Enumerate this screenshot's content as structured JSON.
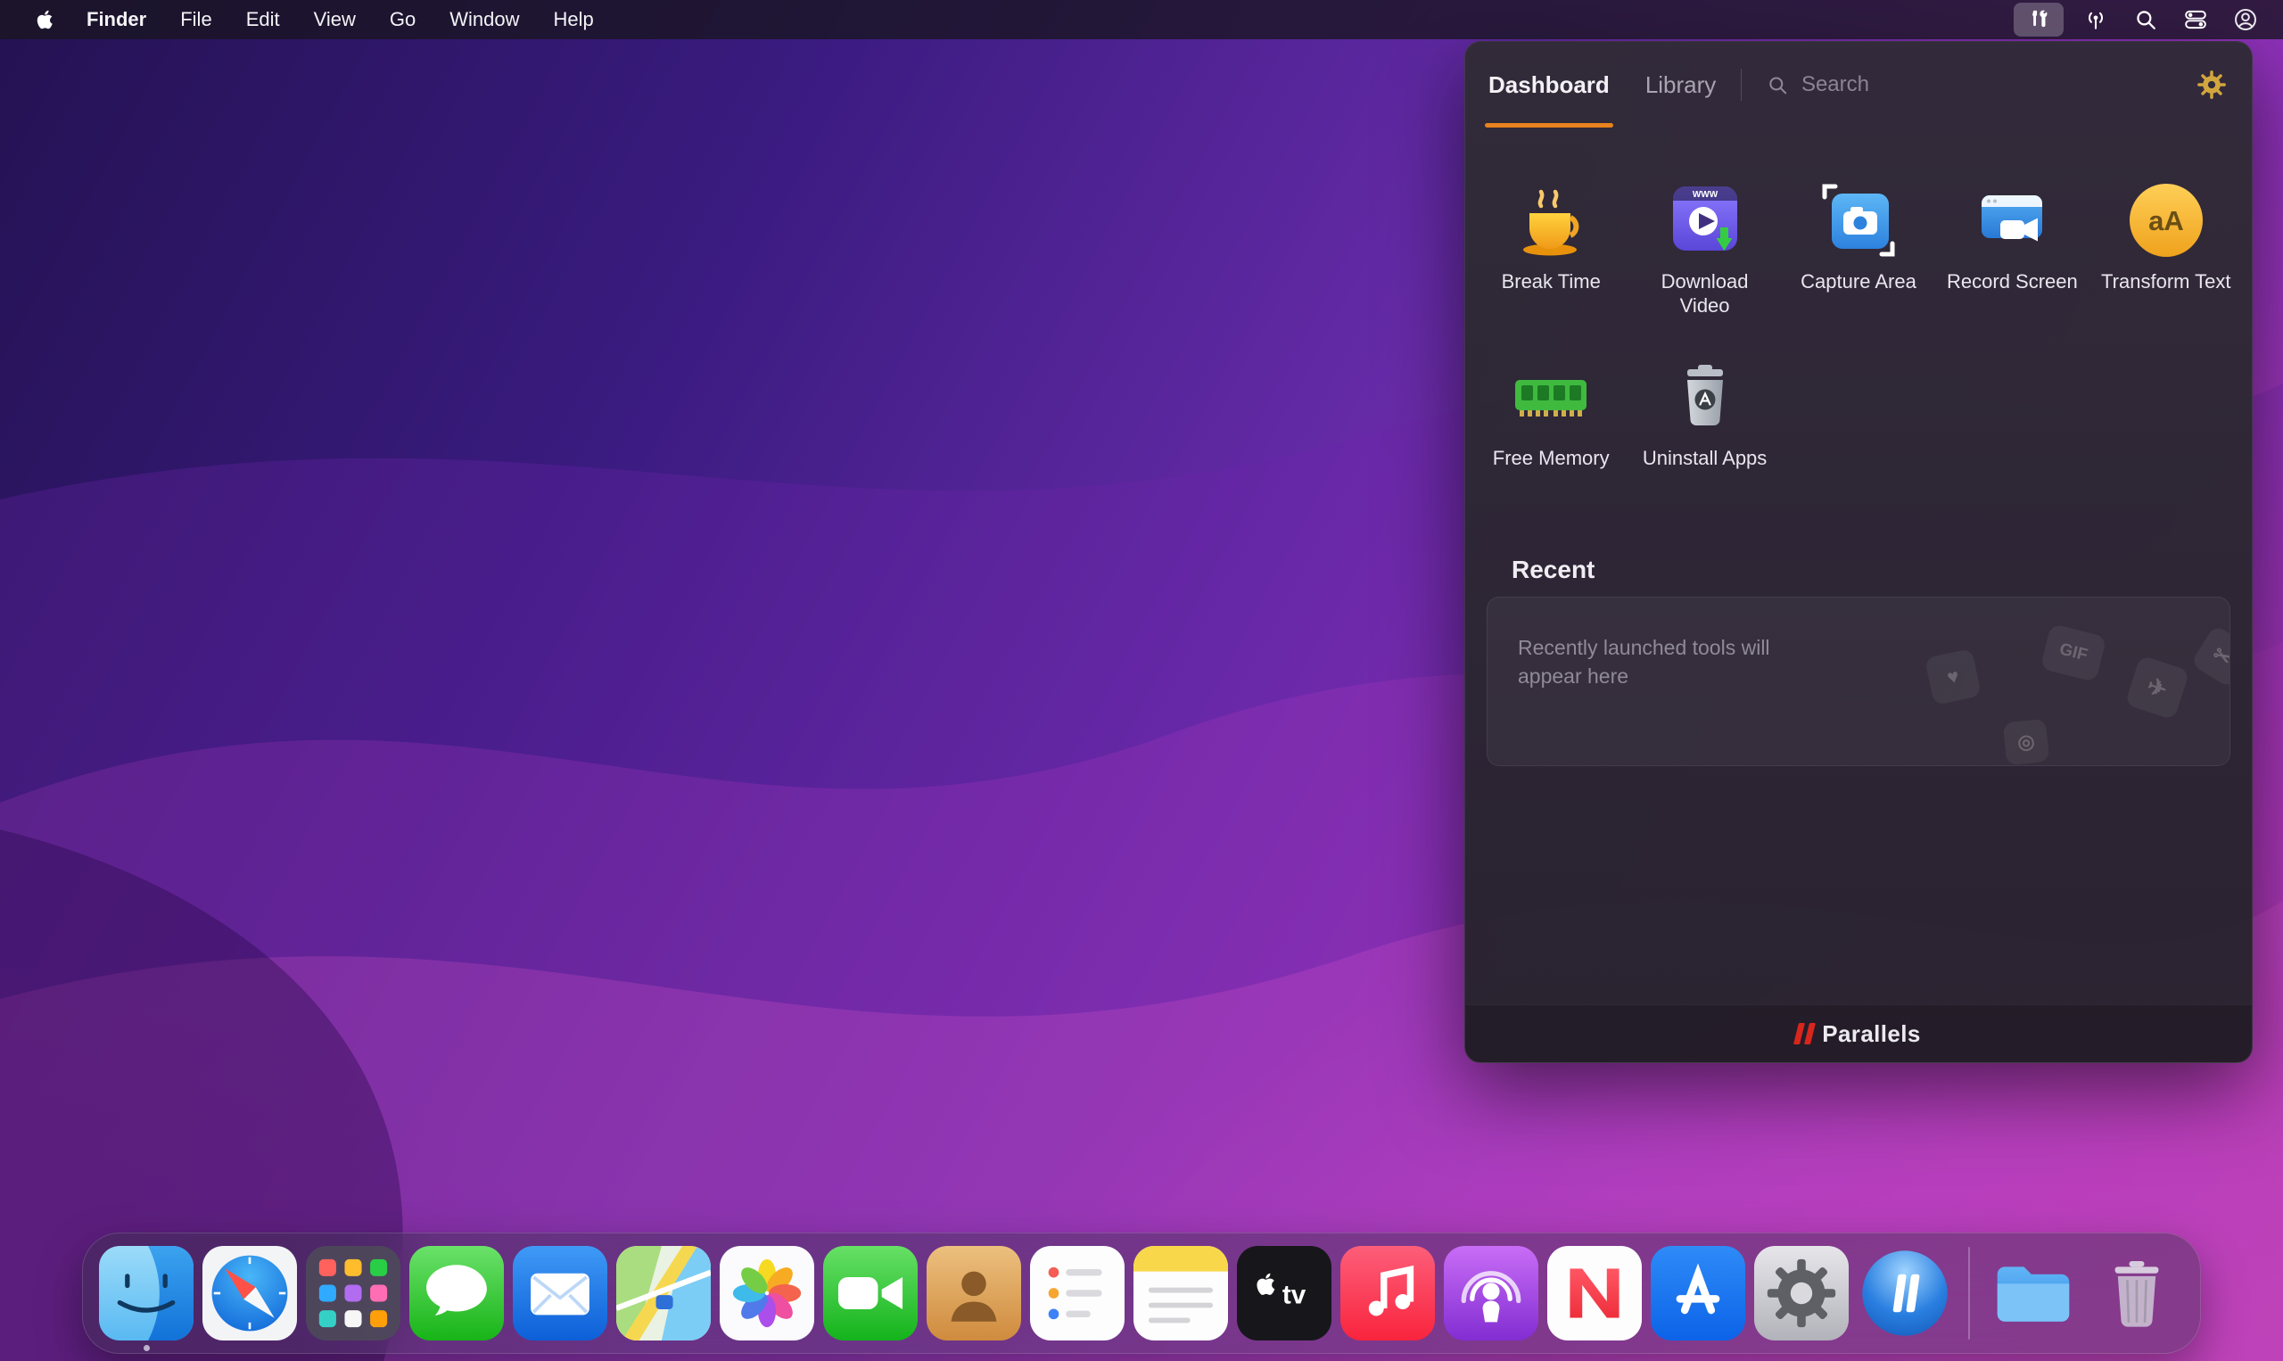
{
  "menu_bar": {
    "app_name": "Finder",
    "items": [
      "File",
      "Edit",
      "View",
      "Go",
      "Window",
      "Help"
    ],
    "status_icons": [
      "parallels-toolbox",
      "wireless-antenna",
      "spotlight-search",
      "control-center",
      "account"
    ]
  },
  "panel": {
    "tabs": [
      {
        "label": "Dashboard",
        "active": true
      },
      {
        "label": "Library",
        "active": false
      }
    ],
    "search": {
      "placeholder": "Search"
    },
    "tools": [
      {
        "label": "Break Time",
        "icon": "coffee-cup-icon"
      },
      {
        "label": "Download Video",
        "icon": "download-video-icon",
        "badge": "WWW"
      },
      {
        "label": "Capture Area",
        "icon": "capture-area-icon"
      },
      {
        "label": "Record Screen",
        "icon": "record-screen-icon"
      },
      {
        "label": "Transform Text",
        "icon": "transform-text-icon",
        "icon_text": "aA"
      },
      {
        "label": "Free Memory",
        "icon": "ram-icon"
      },
      {
        "label": "Uninstall Apps",
        "icon": "uninstall-apps-icon"
      }
    ],
    "recent": {
      "heading": "Recent",
      "empty_text": "Recently launched tools will appear here",
      "ghost_icons": [
        {
          "name": "heart",
          "glyph": "♥"
        },
        {
          "name": "gif",
          "glyph": "GIF"
        },
        {
          "name": "camera",
          "glyph": "◎"
        },
        {
          "name": "airplane",
          "glyph": "✈"
        },
        {
          "name": "sticker",
          "glyph": "✂"
        }
      ]
    },
    "brand": "Parallels"
  },
  "dock": {
    "tv_label": "tv",
    "apps": [
      "Finder",
      "Safari",
      "Launchpad",
      "Messages",
      "Mail",
      "Maps",
      "Photos",
      "FaceTime",
      "Contacts",
      "Reminders",
      "Notes",
      "TV",
      "Music",
      "Podcasts",
      "News",
      "App Store",
      "System Preferences",
      "Parallels Desktop",
      "Downloads",
      "Trash"
    ]
  },
  "colors": {
    "accent_orange": "#e8821e",
    "parallels_red": "#d9261c",
    "menubar_bg": "#181420",
    "panel_bg": "#2d2935"
  }
}
